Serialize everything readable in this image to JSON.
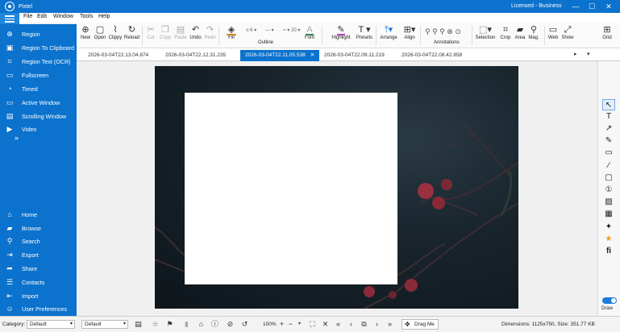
{
  "titlebar": {
    "app_title": "Pixtel",
    "license": "Licensed - Business",
    "minimize": "—",
    "maximize": "☐",
    "close": "✕"
  },
  "menu": [
    "File",
    "Edit",
    "Window",
    "Tools",
    "Help"
  ],
  "sidebar": {
    "capture": [
      {
        "label": "Region",
        "icon": "crosshair-icon"
      },
      {
        "label": "Region To Clipboard",
        "icon": "clipboard-icon"
      },
      {
        "label": "Region Text (OCR)",
        "icon": "ocr-icon"
      },
      {
        "label": "Fullscreen",
        "icon": "monitor-icon"
      },
      {
        "label": "Timed",
        "icon": "timer-icon"
      },
      {
        "label": "Active Window",
        "icon": "window-icon"
      },
      {
        "label": "Scrolling Window",
        "icon": "scroll-window-icon"
      },
      {
        "label": "Video",
        "icon": "video-icon"
      }
    ],
    "more": "»",
    "nav": [
      {
        "label": "Home",
        "icon": "home-icon"
      },
      {
        "label": "Browse",
        "icon": "folder-icon"
      },
      {
        "label": "Search",
        "icon": "search-icon"
      },
      {
        "label": "Export",
        "icon": "export-icon"
      },
      {
        "label": "Share",
        "icon": "share-icon"
      },
      {
        "label": "Contacts",
        "icon": "contacts-icon"
      },
      {
        "label": "Import",
        "icon": "import-icon"
      },
      {
        "label": "User Preferences",
        "icon": "user-icon"
      }
    ]
  },
  "toolbar": {
    "new": "New",
    "open": "Open",
    "clippy": "Clippy",
    "reload": "Reload",
    "cut": "Cut",
    "copy": "Copy",
    "paste": "Paste",
    "undo": "Undo",
    "redo": "Redo",
    "fill": "Fill",
    "outline": "Outline",
    "font": "Font",
    "highlight": "Highlight",
    "presets": "Presets",
    "arrange": "Arrange",
    "align": "Align",
    "annotations": "Annotations",
    "selection": "Selection",
    "crop": "Crop",
    "area": "Area",
    "mag": "Mag.",
    "web": "Web",
    "show": "Show",
    "grid": "Grid",
    "outline_width": "6",
    "font_size": "20"
  },
  "tabs": [
    {
      "label": "2026-03-04T22.13.04.874",
      "active": false
    },
    {
      "label": "2026-03-04T22.12.31.235",
      "active": false
    },
    {
      "label": "2026-03-04T22.11.05.538",
      "active": true,
      "close": "✕"
    },
    {
      "label": "2026-03-04T22.09.11.219",
      "active": false
    },
    {
      "label": "2026-03-04T22.08.42.858",
      "active": false
    }
  ],
  "right_tools": {
    "draw_label": "Draw"
  },
  "bottombar": {
    "category_label": "Category:",
    "category_value": "Default",
    "second_value": "Default",
    "zoom": "100%",
    "drag_me": "Drag Me",
    "dimensions": "Dimensions: 1125x750, Size: 351.77 KB"
  },
  "colors": {
    "accent": "#0b72cd",
    "fill_swatch": "#f08a24",
    "font_swatch": "#2e8b57",
    "highlight_swatch": "#c23cc9"
  }
}
